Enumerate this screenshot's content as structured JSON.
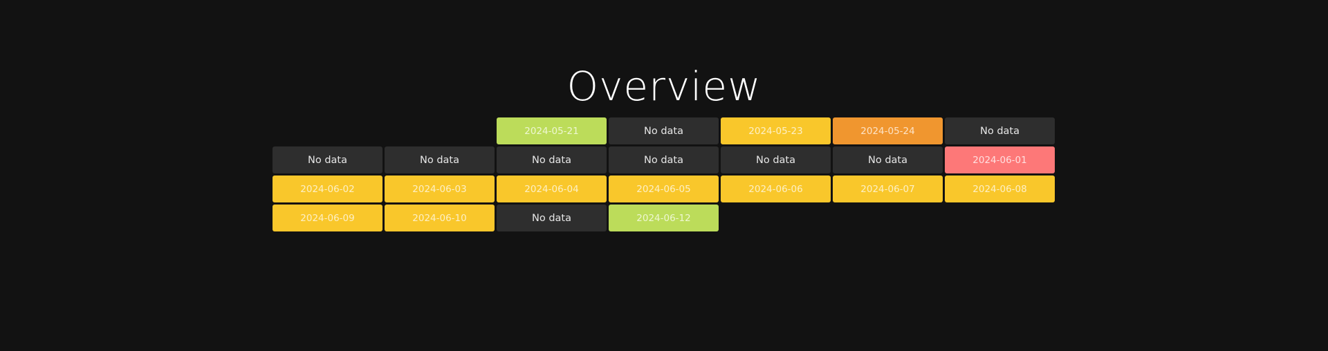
{
  "page": {
    "title": "Overview"
  },
  "colors": {
    "background": "#121212",
    "no_data": "#2e2e2e",
    "green": "#bcdc5a",
    "yellow": "#f9c72b",
    "orange": "#f0962f",
    "red": "#fd7878"
  },
  "calendar": {
    "columns": 7,
    "cells": [
      {
        "label": "",
        "status": "empty"
      },
      {
        "label": "",
        "status": "empty"
      },
      {
        "label": "2024-05-21",
        "status": "green"
      },
      {
        "label": "No data",
        "status": "nodata"
      },
      {
        "label": "2024-05-23",
        "status": "yellow"
      },
      {
        "label": "2024-05-24",
        "status": "orange"
      },
      {
        "label": "No data",
        "status": "nodata"
      },
      {
        "label": "No data",
        "status": "nodata"
      },
      {
        "label": "No data",
        "status": "nodata"
      },
      {
        "label": "No data",
        "status": "nodata"
      },
      {
        "label": "No data",
        "status": "nodata"
      },
      {
        "label": "No data",
        "status": "nodata"
      },
      {
        "label": "No data",
        "status": "nodata"
      },
      {
        "label": "2024-06-01",
        "status": "red"
      },
      {
        "label": "2024-06-02",
        "status": "yellow"
      },
      {
        "label": "2024-06-03",
        "status": "yellow"
      },
      {
        "label": "2024-06-04",
        "status": "yellow"
      },
      {
        "label": "2024-06-05",
        "status": "yellow"
      },
      {
        "label": "2024-06-06",
        "status": "yellow"
      },
      {
        "label": "2024-06-07",
        "status": "yellow"
      },
      {
        "label": "2024-06-08",
        "status": "yellow"
      },
      {
        "label": "2024-06-09",
        "status": "yellow"
      },
      {
        "label": "2024-06-10",
        "status": "yellow"
      },
      {
        "label": "No data",
        "status": "nodata"
      },
      {
        "label": "2024-06-12",
        "status": "green"
      }
    ]
  }
}
